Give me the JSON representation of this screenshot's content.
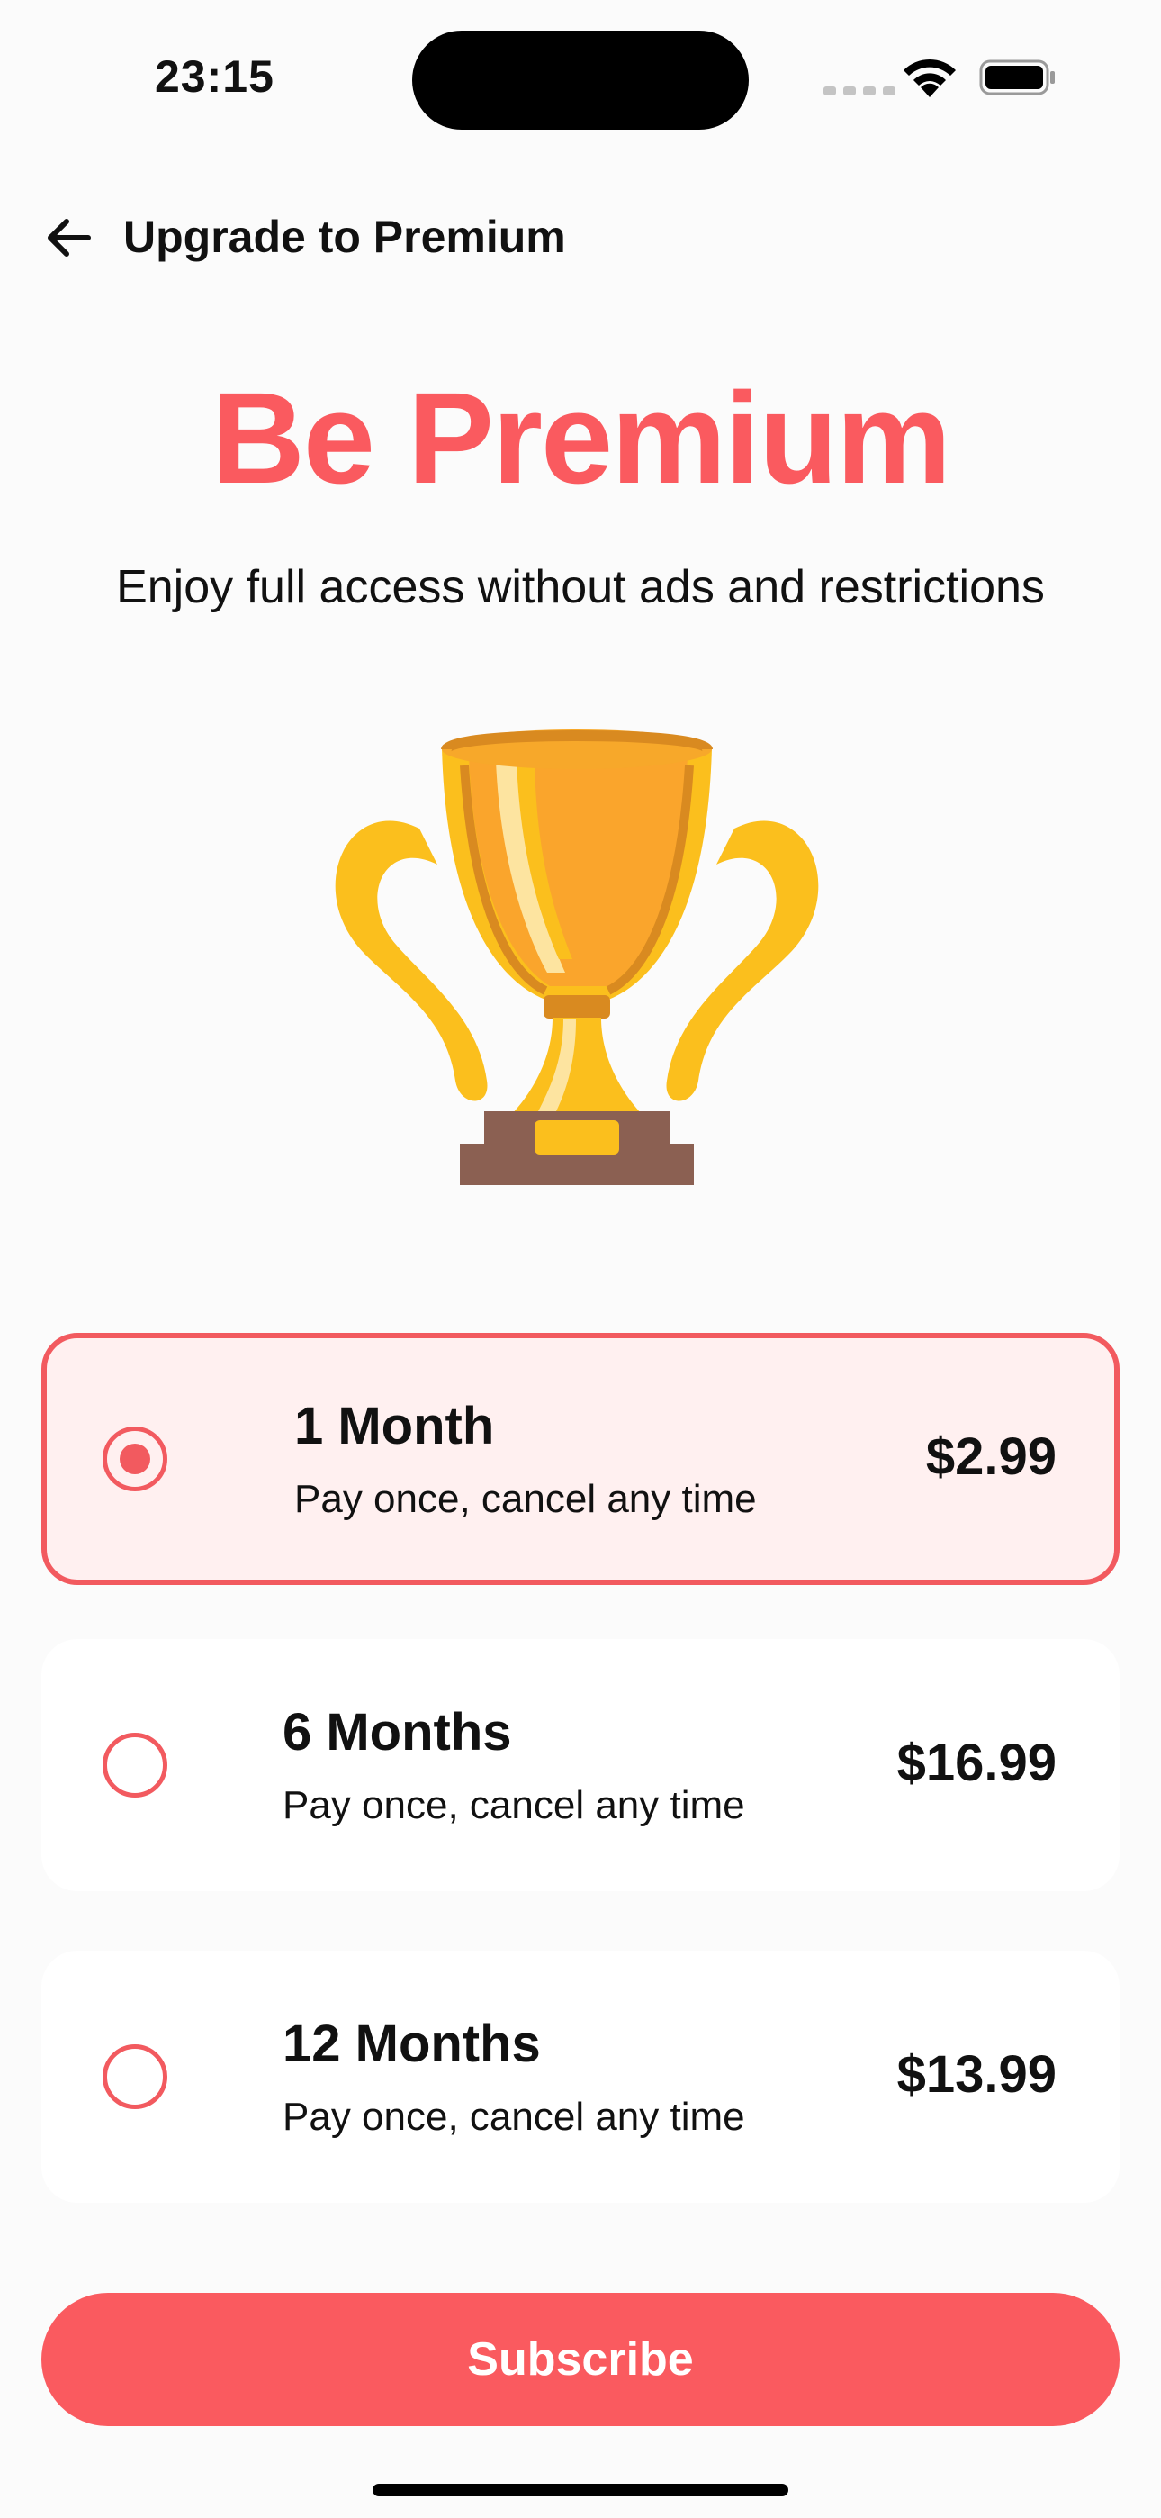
{
  "status_bar": {
    "time": "23:15"
  },
  "header": {
    "back_icon": "arrow-left-icon",
    "title": "Upgrade to Premium"
  },
  "hero": {
    "title": "Be Premium",
    "subtitle": "Enjoy full access without ads and restrictions",
    "image_icon": "trophy-icon"
  },
  "plans": [
    {
      "name": "1 Month",
      "description": "Pay once, cancel any time",
      "price": "$2.99",
      "selected": true
    },
    {
      "name": "6 Months",
      "description": "Pay once, cancel any time",
      "price": "$16.99",
      "selected": false
    },
    {
      "name": "12 Months",
      "description": "Pay once, cancel any time",
      "price": "$13.99",
      "selected": false
    }
  ],
  "subscribe_label": "Subscribe",
  "colors": {
    "accent": "#fa5a5f",
    "selected_background": "#fff0f0",
    "card_background": "#ffffff",
    "page_background": "#fbfbfb"
  }
}
